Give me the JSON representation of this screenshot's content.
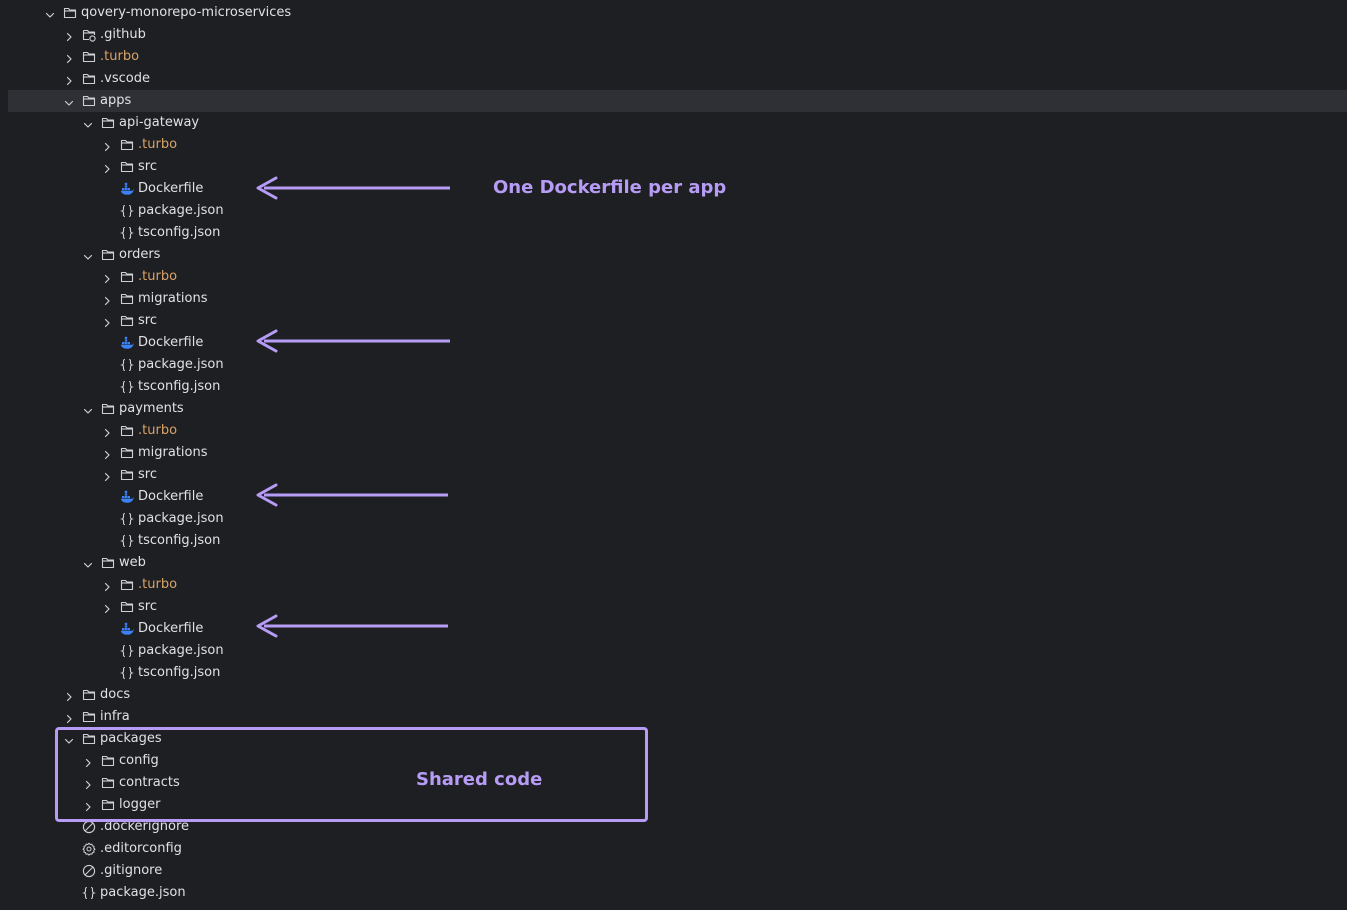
{
  "colors": {
    "background": "#1e1f22",
    "selected_row": "#2e3035",
    "text": "#dfe1e5",
    "excluded_folder_text": "#d9a26a",
    "annotation": "#b69cf5",
    "docker_icon": "#3b82f6",
    "icon_stroke": "#ced0d6"
  },
  "tree": [
    {
      "depth": 0,
      "type": "folder",
      "icon": "folder-icon",
      "expanded": true,
      "label": "qovery-monorepo-microservices"
    },
    {
      "depth": 1,
      "type": "folder",
      "icon": "github-folder-icon",
      "expanded": false,
      "label": ".github"
    },
    {
      "depth": 1,
      "type": "folder",
      "icon": "folder-icon",
      "expanded": false,
      "label": ".turbo",
      "excluded": true
    },
    {
      "depth": 1,
      "type": "folder",
      "icon": "folder-icon",
      "expanded": false,
      "label": ".vscode"
    },
    {
      "depth": 1,
      "type": "folder",
      "icon": "folder-icon",
      "expanded": true,
      "label": "apps",
      "selected": true
    },
    {
      "depth": 2,
      "type": "folder",
      "icon": "folder-icon",
      "expanded": true,
      "label": "api-gateway"
    },
    {
      "depth": 3,
      "type": "folder",
      "icon": "folder-icon",
      "expanded": false,
      "label": ".turbo",
      "excluded": true
    },
    {
      "depth": 3,
      "type": "folder",
      "icon": "folder-icon",
      "expanded": false,
      "label": "src"
    },
    {
      "depth": 3,
      "type": "file",
      "icon": "docker-icon",
      "label": "Dockerfile"
    },
    {
      "depth": 3,
      "type": "file",
      "icon": "json-icon",
      "label": "package.json"
    },
    {
      "depth": 3,
      "type": "file",
      "icon": "json-icon",
      "label": "tsconfig.json"
    },
    {
      "depth": 2,
      "type": "folder",
      "icon": "folder-icon",
      "expanded": true,
      "label": "orders"
    },
    {
      "depth": 3,
      "type": "folder",
      "icon": "folder-icon",
      "expanded": false,
      "label": ".turbo",
      "excluded": true
    },
    {
      "depth": 3,
      "type": "folder",
      "icon": "folder-icon",
      "expanded": false,
      "label": "migrations"
    },
    {
      "depth": 3,
      "type": "folder",
      "icon": "folder-icon",
      "expanded": false,
      "label": "src"
    },
    {
      "depth": 3,
      "type": "file",
      "icon": "docker-icon",
      "label": "Dockerfile"
    },
    {
      "depth": 3,
      "type": "file",
      "icon": "json-icon",
      "label": "package.json"
    },
    {
      "depth": 3,
      "type": "file",
      "icon": "json-icon",
      "label": "tsconfig.json"
    },
    {
      "depth": 2,
      "type": "folder",
      "icon": "folder-icon",
      "expanded": true,
      "label": "payments"
    },
    {
      "depth": 3,
      "type": "folder",
      "icon": "folder-icon",
      "expanded": false,
      "label": ".turbo",
      "excluded": true
    },
    {
      "depth": 3,
      "type": "folder",
      "icon": "folder-icon",
      "expanded": false,
      "label": "migrations"
    },
    {
      "depth": 3,
      "type": "folder",
      "icon": "folder-icon",
      "expanded": false,
      "label": "src"
    },
    {
      "depth": 3,
      "type": "file",
      "icon": "docker-icon",
      "label": "Dockerfile"
    },
    {
      "depth": 3,
      "type": "file",
      "icon": "json-icon",
      "label": "package.json"
    },
    {
      "depth": 3,
      "type": "file",
      "icon": "json-icon",
      "label": "tsconfig.json"
    },
    {
      "depth": 2,
      "type": "folder",
      "icon": "folder-icon",
      "expanded": true,
      "label": "web"
    },
    {
      "depth": 3,
      "type": "folder",
      "icon": "folder-icon",
      "expanded": false,
      "label": ".turbo",
      "excluded": true
    },
    {
      "depth": 3,
      "type": "folder",
      "icon": "folder-icon",
      "expanded": false,
      "label": "src"
    },
    {
      "depth": 3,
      "type": "file",
      "icon": "docker-icon",
      "label": "Dockerfile"
    },
    {
      "depth": 3,
      "type": "file",
      "icon": "json-icon",
      "label": "package.json"
    },
    {
      "depth": 3,
      "type": "file",
      "icon": "json-icon",
      "label": "tsconfig.json"
    },
    {
      "depth": 1,
      "type": "folder",
      "icon": "folder-icon",
      "expanded": false,
      "label": "docs"
    },
    {
      "depth": 1,
      "type": "folder",
      "icon": "folder-icon",
      "expanded": false,
      "label": "infra"
    },
    {
      "depth": 1,
      "type": "folder",
      "icon": "folder-icon",
      "expanded": true,
      "label": "packages"
    },
    {
      "depth": 2,
      "type": "folder",
      "icon": "folder-icon",
      "expanded": false,
      "label": "config"
    },
    {
      "depth": 2,
      "type": "folder",
      "icon": "folder-icon",
      "expanded": false,
      "label": "contracts"
    },
    {
      "depth": 2,
      "type": "folder",
      "icon": "folder-icon",
      "expanded": false,
      "label": "logger"
    },
    {
      "depth": 1,
      "type": "file",
      "icon": "ignore-icon",
      "label": ".dockerignore"
    },
    {
      "depth": 1,
      "type": "file",
      "icon": "settings-icon",
      "label": ".editorconfig"
    },
    {
      "depth": 1,
      "type": "file",
      "icon": "ignore-icon",
      "label": ".gitignore"
    },
    {
      "depth": 1,
      "type": "file",
      "icon": "json-icon",
      "label": "package.json"
    }
  ],
  "annotations": {
    "dockerfile_note": "One Dockerfile per app",
    "shared_code_note": "Shared code"
  }
}
